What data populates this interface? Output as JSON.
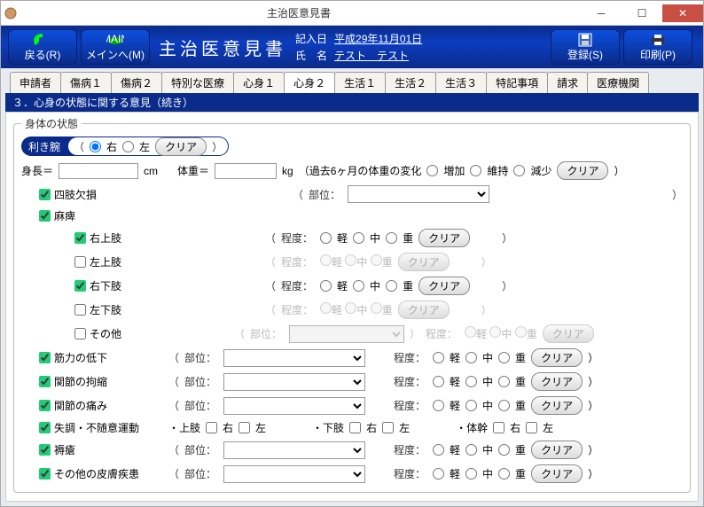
{
  "window": {
    "title": "主治医意見書"
  },
  "toolbar": {
    "back": "戻る(R)",
    "main": "メインへ(M)",
    "doc_title": "主治医意見書",
    "meta_date_label": "記入日",
    "meta_date": "平成29年11月01日",
    "meta_name_label": "氏　名",
    "meta_name": "テスト　テスト",
    "register": "登録(S)",
    "print": "印刷(P)"
  },
  "tabs": [
    "申請者",
    "傷病１",
    "傷病２",
    "特別な医療",
    "心身１",
    "心身２",
    "生活１",
    "生活２",
    "生活３",
    "特記事項",
    "請求",
    "医療機関"
  ],
  "active_tab": "心身２",
  "section_title": "３．心身の状態に関する意見（続き）",
  "fieldset_legend": "身体の状態",
  "dominant_arm": {
    "label": "利き腕",
    "right": "右",
    "left": "左"
  },
  "clear": "クリア",
  "height_label": "身長＝",
  "height_unit": "cm",
  "weight_label": "体重＝",
  "weight_unit": "kg",
  "weight_change": "（過去6ヶ月の体重の変化",
  "inc": "増加",
  "keep": "維持",
  "dec": "減少",
  "site": "部位：",
  "degree": "程度：",
  "limb_loss": "四肢欠損",
  "paralysis": "麻痺",
  "ru": "右上肢",
  "lu": "左上肢",
  "rl": "右下肢",
  "ll": "左下肢",
  "other": "その他",
  "muscle": "筋力の低下",
  "contracture": "関節の拘縮",
  "pain": "関節の痛み",
  "ataxia": "失調・不随意運動",
  "bedsore": "褥瘡",
  "skin": "その他の皮膚疾患",
  "upper_limb": "・上肢",
  "lower_limb": "・下肢",
  "trunk": "・体幹",
  "r": "右",
  "l": "左",
  "sev": {
    "light": "軽",
    "mid": "中",
    "heavy": "重"
  }
}
